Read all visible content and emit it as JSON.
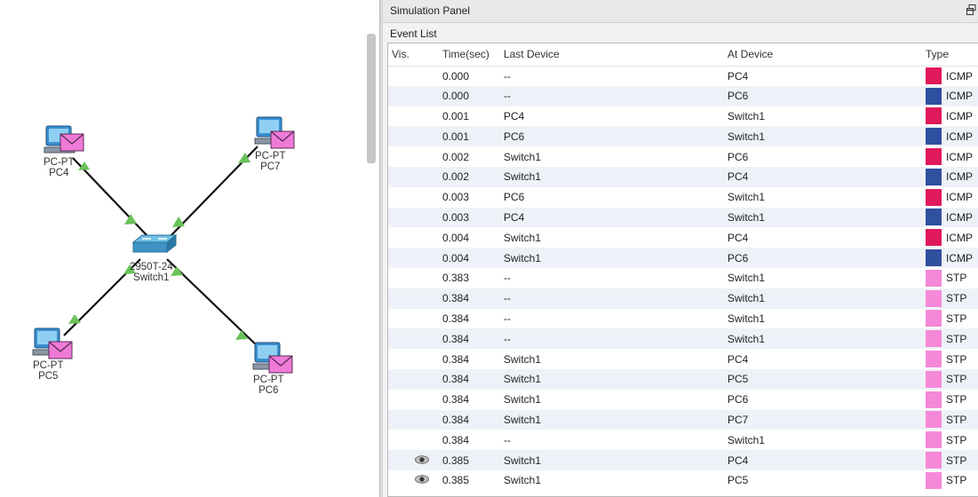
{
  "topology": {
    "devices": [
      {
        "id": "pc4",
        "model": "PC-PT",
        "name": "PC4"
      },
      {
        "id": "pc7",
        "model": "PC-PT",
        "name": "PC7"
      },
      {
        "id": "pc5",
        "model": "PC-PT",
        "name": "PC5"
      },
      {
        "id": "pc6",
        "model": "PC-PT",
        "name": "PC6"
      },
      {
        "id": "switch1",
        "model": "2950T-24",
        "name": "Switch1"
      }
    ],
    "link_color": "#111111",
    "link_up_color": "#6ac259"
  },
  "sim_panel": {
    "title": "Simulation Panel",
    "event_list_label": "Event List",
    "columns": [
      "Vis.",
      "Time(sec)",
      "Last Device",
      "At Device",
      "Type"
    ],
    "type_colors": {
      "icmp_a": "#e0195b",
      "icmp_b": "#2f4f9f",
      "stp": "#f688d8"
    },
    "rows": [
      {
        "vis": "",
        "time": "0.000",
        "last": "--",
        "at": "PC4",
        "type": "ICMP",
        "color": "#e0195b"
      },
      {
        "vis": "",
        "time": "0.000",
        "last": "--",
        "at": "PC6",
        "type": "ICMP",
        "color": "#2f4f9f"
      },
      {
        "vis": "",
        "time": "0.001",
        "last": "PC4",
        "at": "Switch1",
        "type": "ICMP",
        "color": "#e0195b"
      },
      {
        "vis": "",
        "time": "0.001",
        "last": "PC6",
        "at": "Switch1",
        "type": "ICMP",
        "color": "#2f4f9f"
      },
      {
        "vis": "",
        "time": "0.002",
        "last": "Switch1",
        "at": "PC6",
        "type": "ICMP",
        "color": "#e0195b"
      },
      {
        "vis": "",
        "time": "0.002",
        "last": "Switch1",
        "at": "PC4",
        "type": "ICMP",
        "color": "#2f4f9f"
      },
      {
        "vis": "",
        "time": "0.003",
        "last": "PC6",
        "at": "Switch1",
        "type": "ICMP",
        "color": "#e0195b"
      },
      {
        "vis": "",
        "time": "0.003",
        "last": "PC4",
        "at": "Switch1",
        "type": "ICMP",
        "color": "#2f4f9f"
      },
      {
        "vis": "",
        "time": "0.004",
        "last": "Switch1",
        "at": "PC4",
        "type": "ICMP",
        "color": "#e0195b"
      },
      {
        "vis": "",
        "time": "0.004",
        "last": "Switch1",
        "at": "PC6",
        "type": "ICMP",
        "color": "#2f4f9f"
      },
      {
        "vis": "",
        "time": "0.383",
        "last": "--",
        "at": "Switch1",
        "type": "STP",
        "color": "#f688d8"
      },
      {
        "vis": "",
        "time": "0.384",
        "last": "--",
        "at": "Switch1",
        "type": "STP",
        "color": "#f688d8"
      },
      {
        "vis": "",
        "time": "0.384",
        "last": "--",
        "at": "Switch1",
        "type": "STP",
        "color": "#f688d8"
      },
      {
        "vis": "",
        "time": "0.384",
        "last": "--",
        "at": "Switch1",
        "type": "STP",
        "color": "#f688d8"
      },
      {
        "vis": "",
        "time": "0.384",
        "last": "Switch1",
        "at": "PC4",
        "type": "STP",
        "color": "#f688d8"
      },
      {
        "vis": "",
        "time": "0.384",
        "last": "Switch1",
        "at": "PC5",
        "type": "STP",
        "color": "#f688d8"
      },
      {
        "vis": "",
        "time": "0.384",
        "last": "Switch1",
        "at": "PC6",
        "type": "STP",
        "color": "#f688d8"
      },
      {
        "vis": "",
        "time": "0.384",
        "last": "Switch1",
        "at": "PC7",
        "type": "STP",
        "color": "#f688d8"
      },
      {
        "vis": "",
        "time": "0.384",
        "last": "--",
        "at": "Switch1",
        "type": "STP",
        "color": "#f688d8"
      },
      {
        "vis": "eye-icon",
        "time": "0.385",
        "last": "Switch1",
        "at": "PC4",
        "type": "STP",
        "color": "#f688d8"
      },
      {
        "vis": "eye-icon",
        "time": "0.385",
        "last": "Switch1",
        "at": "PC5",
        "type": "STP",
        "color": "#f688d8"
      }
    ]
  }
}
